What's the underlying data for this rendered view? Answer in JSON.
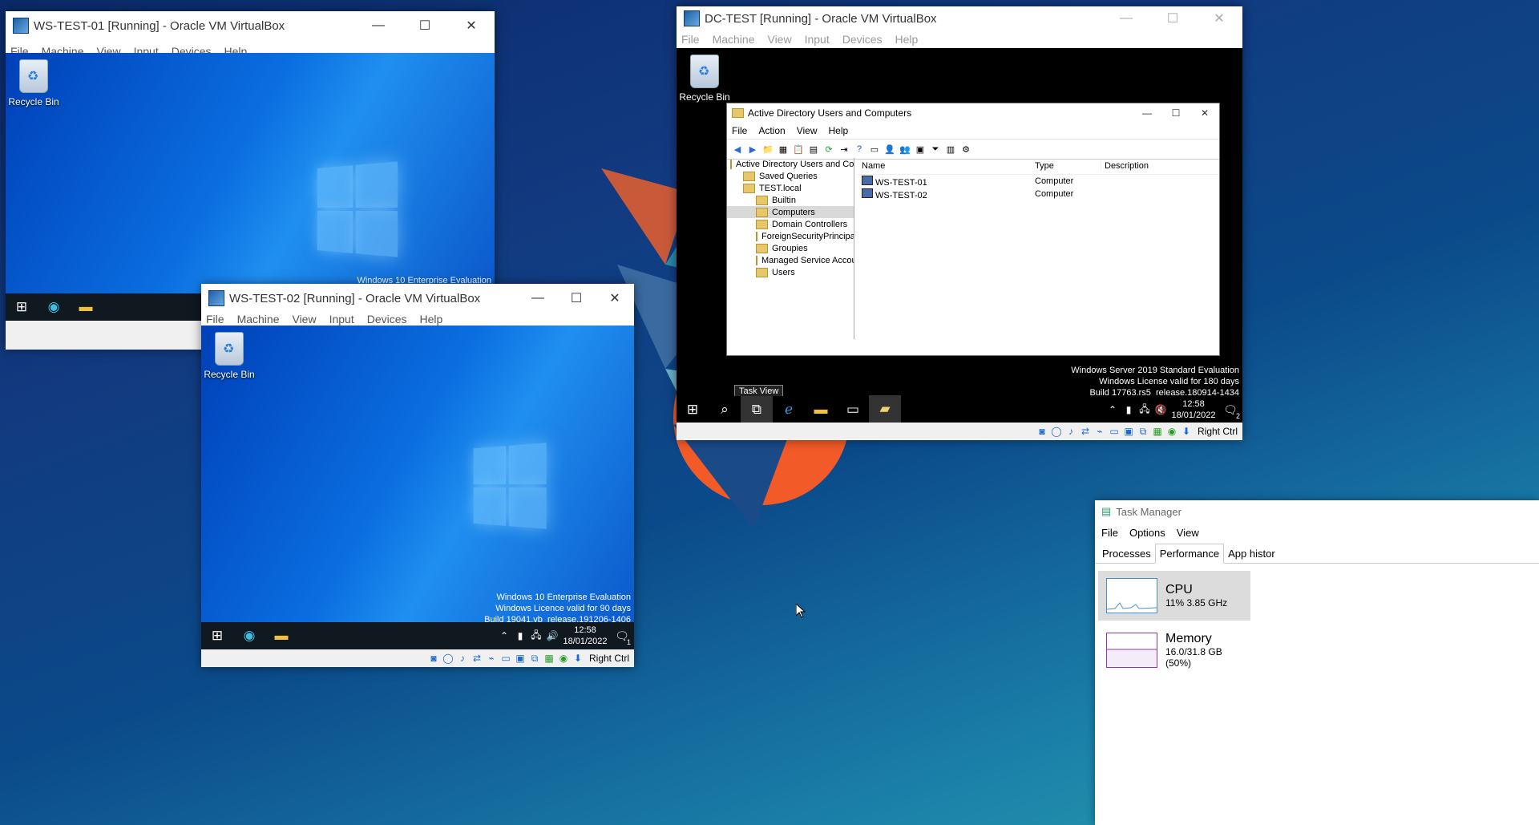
{
  "vm1": {
    "title": "WS-TEST-01 [Running] - Oracle VM VirtualBox",
    "menu": [
      "File",
      "Machine",
      "View",
      "Input",
      "Devices",
      "Help"
    ],
    "recycle_bin": "Recycle Bin",
    "watermark": "Windows 10 Enterprise Evaluation"
  },
  "vm2": {
    "title": "WS-TEST-02 [Running] - Oracle VM VirtualBox",
    "menu": [
      "File",
      "Machine",
      "View",
      "Input",
      "Devices",
      "Help"
    ],
    "recycle_bin": "Recycle Bin",
    "watermark": [
      "Windows 10 Enterprise Evaluation",
      "Windows Licence valid for 90 days",
      "Build 19041.vb_release.191206-1406"
    ],
    "clock_time": "12:58",
    "clock_date": "18/01/2022",
    "notif_count": "1",
    "host_key": "Right Ctrl"
  },
  "dc": {
    "title": "DC-TEST [Running] - Oracle VM VirtualBox",
    "menu": [
      "File",
      "Machine",
      "View",
      "Input",
      "Devices",
      "Help"
    ],
    "recycle_bin": "Recycle Bin",
    "watermark": [
      "Windows Server 2019 Standard Evaluation",
      "Windows License valid for 180 days",
      "Build 17763.rs5_release.180914-1434"
    ],
    "tooltip": "Task View",
    "clock_time": "12:58",
    "clock_date": "18/01/2022",
    "notif_count": "2",
    "host_key": "Right Ctrl"
  },
  "ad": {
    "title": "Active Directory Users and Computers",
    "menu": [
      "File",
      "Action",
      "View",
      "Help"
    ],
    "tree_root": "Active Directory Users and Com",
    "tree": [
      "Saved Queries",
      "TEST.local",
      "Builtin",
      "Computers",
      "Domain Controllers",
      "ForeignSecurityPrincipals",
      "Groupies",
      "Managed Service Accour",
      "Users"
    ],
    "columns": [
      "Name",
      "Type",
      "Description"
    ],
    "rows": [
      {
        "name": "WS-TEST-01",
        "type": "Computer",
        "desc": ""
      },
      {
        "name": "WS-TEST-02",
        "type": "Computer",
        "desc": ""
      }
    ]
  },
  "taskmgr": {
    "title": "Task Manager",
    "menu": [
      "File",
      "Options",
      "View"
    ],
    "tabs": [
      "Processes",
      "Performance",
      "App histor"
    ],
    "cpu_label": "CPU",
    "cpu_value": "11%  3.85 GHz",
    "mem_label": "Memory",
    "mem_value": "16.0/31.8 GB (50%)"
  }
}
